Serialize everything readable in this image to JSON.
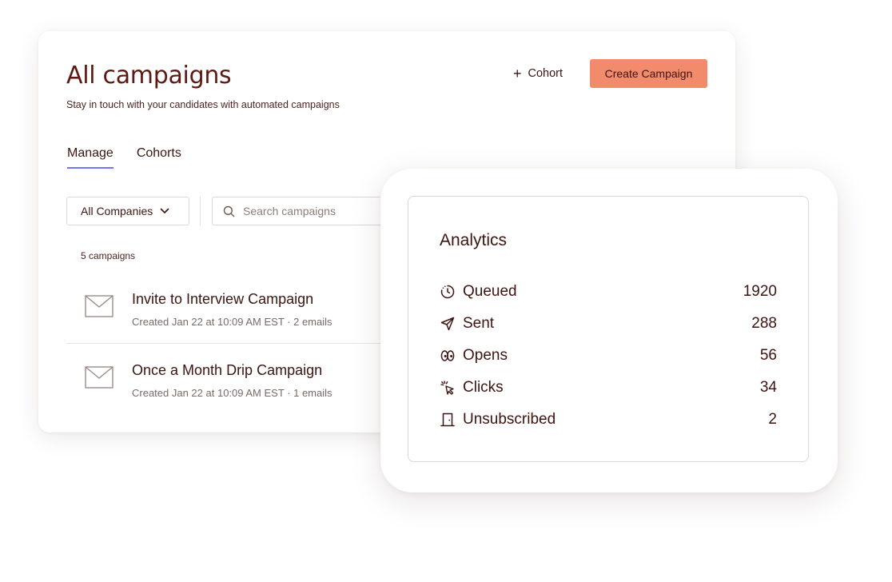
{
  "header": {
    "title": "All campaigns",
    "subtitle": "Stay in touch with your candidates with automated campaigns",
    "cohort_button": "Cohort",
    "create_button": "Create Campaign"
  },
  "tabs": [
    {
      "label": "Manage",
      "active": true
    },
    {
      "label": "Cohorts",
      "active": false
    }
  ],
  "filters": {
    "company_select": "All Companies",
    "search_placeholder": "Search campaigns"
  },
  "campaign_count": "5 campaigns",
  "campaigns": [
    {
      "name": "Invite to Interview Campaign",
      "meta": "Created Jan 22 at 10:09 AM EST · 2 emails"
    },
    {
      "name": "Once a Month Drip Campaign",
      "meta": "Created Jan 22 at 10:09 AM EST · 1 emails"
    }
  ],
  "analytics": {
    "title": "Analytics",
    "metrics": [
      {
        "label": "Queued",
        "value": "1920",
        "icon": "clock-icon"
      },
      {
        "label": "Sent",
        "value": "288",
        "icon": "send-icon"
      },
      {
        "label": "Opens",
        "value": "56",
        "icon": "eyes-icon"
      },
      {
        "label": "Clicks",
        "value": "34",
        "icon": "cursor-click-icon"
      },
      {
        "label": "Unsubscribed",
        "value": "2",
        "icon": "door-icon"
      }
    ]
  },
  "colors": {
    "accent": "#f28a6c",
    "title": "#5e1a12",
    "text": "#3d1510",
    "tab_underline": "#6f78e8"
  }
}
